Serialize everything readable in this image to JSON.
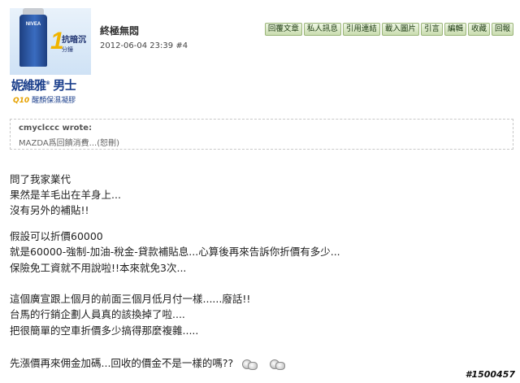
{
  "avatar": {
    "product_brand": "NIVEA",
    "badge_number": "1",
    "badge_line1": "抗暗沉",
    "badge_line2": "分鐘",
    "brand_name": "妮維雅",
    "brand_suffix": "男士",
    "sub_code": "Q10",
    "sub_text": "醒顏保濕凝膠"
  },
  "post": {
    "username": "終極無悶",
    "datetime": "2012-06-04 23:39",
    "post_number": "#4"
  },
  "toolbar": {
    "buttons": [
      "回覆文章",
      "私人訊息",
      "引用連結",
      "載入圖片",
      "引言",
      "編輯",
      "收藏",
      "回報"
    ]
  },
  "quote": {
    "author": "cmyclccc wrote:",
    "text": "MAZDA爲回饋消費...(恕刪)"
  },
  "body_lines": [
    "問了我家業代",
    "果然是羊毛出在羊身上...",
    "沒有另外的補貼!!",
    "",
    "假設可以折價60000",
    "就是60000-強制-加油-稅金-貸款補貼息...心算後再來告訴你折價有多少...",
    "保險免工資就不用說啦!!本來就免3次...",
    "",
    "這個廣宣跟上個月的前面三個月低月付一樣......廢話!!",
    "台馬的行銷企劃人員真的該換掉了啦....",
    "把很簡單的空車折價多少搞得那麼複雜.....",
    "",
    "先漲價再來佣金加碼...回收的價金不是一樣的嗎??"
  ],
  "emoticons": [
    "sweat-emoticon",
    "sweat-emoticon"
  ],
  "watermark": "#1500457"
}
